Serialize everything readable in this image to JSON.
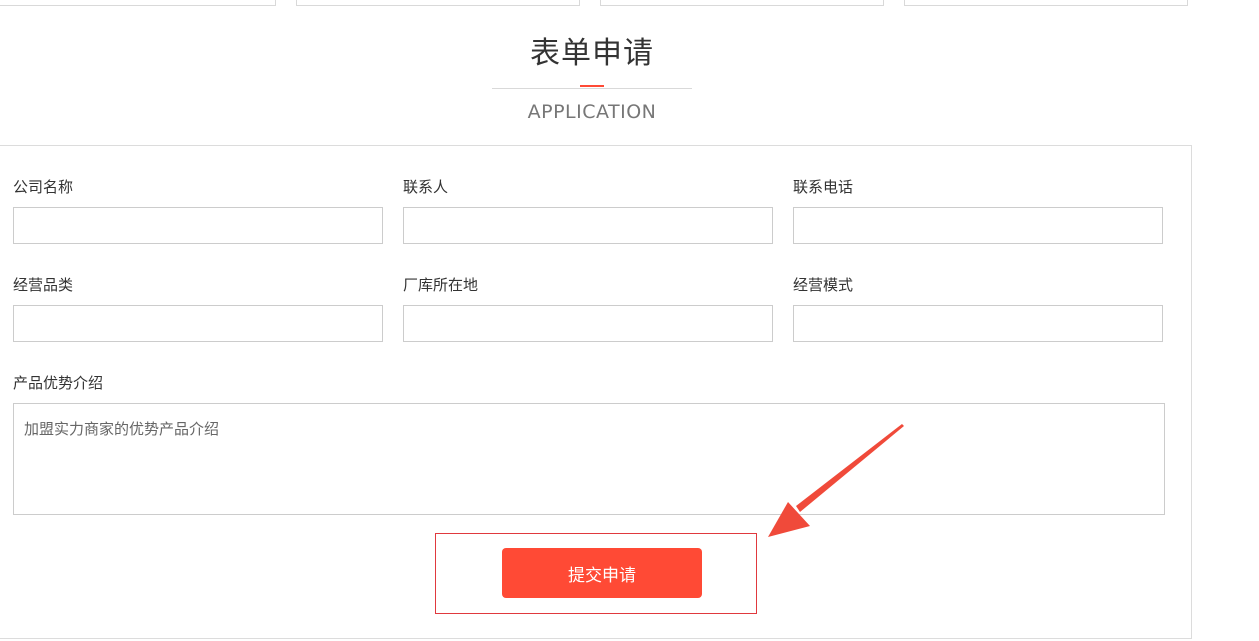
{
  "heading": {
    "title": "表单申请",
    "subtitle": "APPLICATION"
  },
  "form": {
    "row1": [
      {
        "label": "公司名称",
        "value": ""
      },
      {
        "label": "联系人",
        "value": ""
      },
      {
        "label": "联系电话",
        "value": ""
      }
    ],
    "row2": [
      {
        "label": "经营品类",
        "value": ""
      },
      {
        "label": "厂库所在地",
        "value": ""
      },
      {
        "label": "经营模式",
        "value": ""
      }
    ],
    "intro": {
      "label": "产品优势介绍",
      "placeholder": "加盟实力商家的优势产品介绍"
    },
    "submit_label": "提交申请"
  },
  "colors": {
    "accent": "#ff4a35",
    "annotation": "#e0393e"
  },
  "icons": {
    "annotation_arrow": "arrow-icon"
  }
}
